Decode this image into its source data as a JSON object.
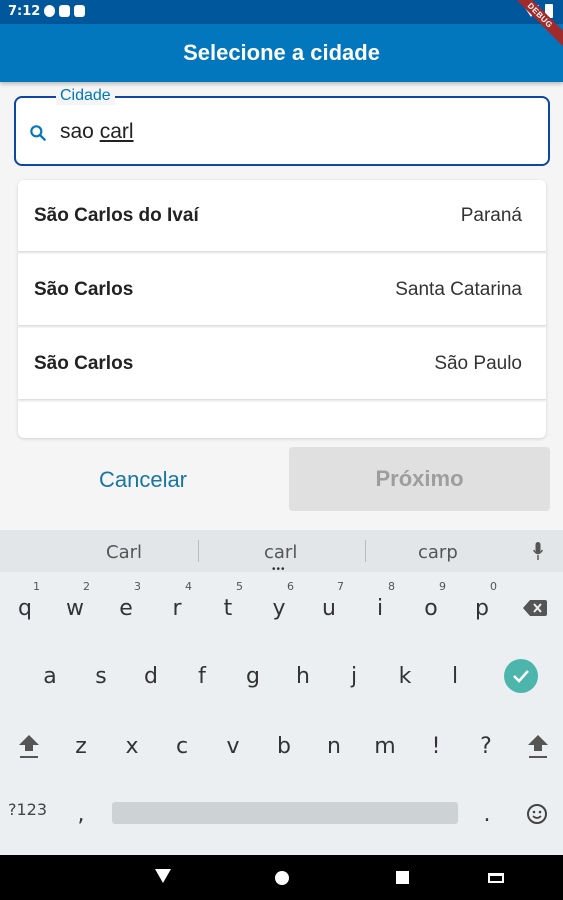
{
  "status_bar": {
    "time": "7:12"
  },
  "debug_banner": "DEBUG",
  "app_bar": {
    "title": "Selecione a cidade"
  },
  "search": {
    "label": "Cidade",
    "value_prefix": "sao ",
    "value_composing": "carl"
  },
  "results": [
    {
      "city": "São Carlos do Ivaí",
      "state": "Paraná"
    },
    {
      "city": "São Carlos",
      "state": "Santa Catarina"
    },
    {
      "city": "São Carlos",
      "state": "São Paulo"
    }
  ],
  "actions": {
    "cancel_label": "Cancelar",
    "next_label": "Próximo",
    "next_enabled": false
  },
  "keyboard": {
    "suggestions": [
      "Carl",
      "carl",
      "carp"
    ],
    "row1": [
      {
        "k": "q",
        "hint": "1"
      },
      {
        "k": "w",
        "hint": "2"
      },
      {
        "k": "e",
        "hint": "3"
      },
      {
        "k": "r",
        "hint": "4"
      },
      {
        "k": "t",
        "hint": "5"
      },
      {
        "k": "y",
        "hint": "6"
      },
      {
        "k": "u",
        "hint": "7"
      },
      {
        "k": "i",
        "hint": "8"
      },
      {
        "k": "o",
        "hint": "9"
      },
      {
        "k": "p",
        "hint": "0"
      }
    ],
    "row2": [
      "a",
      "s",
      "d",
      "f",
      "g",
      "h",
      "j",
      "k",
      "l"
    ],
    "row3": [
      "z",
      "x",
      "c",
      "v",
      "b",
      "n",
      "m",
      "!",
      "?"
    ],
    "symbols_label": "?123",
    "comma": ",",
    "period": "."
  },
  "colors": {
    "app_bar": "#0277bd",
    "status_bar": "#01579b",
    "focus_border": "#0d47a1",
    "accent": "#1976a3",
    "enter_key": "#4db6ac"
  }
}
